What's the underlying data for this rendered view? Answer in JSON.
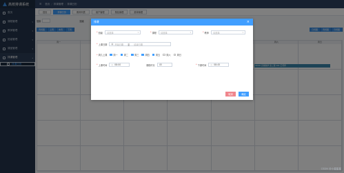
{
  "app": {
    "title": "高校排课系统"
  },
  "sidebar": {
    "items": [
      {
        "label": "首页"
      },
      {
        "label": "课程管理"
      },
      {
        "label": "教师管理"
      },
      {
        "label": "班级管理"
      },
      {
        "label": "课室管理"
      },
      {
        "label": "排课管理"
      },
      {
        "label": "排课日历"
      }
    ]
  },
  "header": {
    "crumbs": [
      "首页",
      "排课管理",
      "排课日历"
    ]
  },
  "tabs": [
    "首页",
    "排课日历",
    "教师列表",
    "用户管理",
    "角色管理",
    "菜单管理"
  ],
  "toolbar": {
    "search_label": "搜索",
    "class_label": "班级"
  },
  "calendar": {
    "view_buttons": [
      "周视图",
      "上周",
      "本周",
      "下周"
    ],
    "view_buttons_right": [
      "日视图",
      "周视图",
      "月视图"
    ],
    "week_days": [
      "周一",
      "周二",
      "周三",
      "周四",
      "周五",
      "周六",
      "周日"
    ],
    "event": "09:00 高等数学 第二课 101 王老师"
  },
  "modal": {
    "title": "排课",
    "close": "×",
    "fields": {
      "class_label": "班级",
      "course_label": "课程",
      "teacher_label": "教师",
      "placeholder": "请选择",
      "date_label": "上课日期",
      "date_start_placeholder": "开始日期",
      "date_sep": "至",
      "date_end_placeholder": "结束日期",
      "weekday_label": "周几上课",
      "weekdays": [
        "周一",
        "周二",
        "周三",
        "周四",
        "周五",
        "周六",
        "周日"
      ],
      "start_time_label": "上课时间",
      "start_time": "08:00",
      "duration_label": "课程时长",
      "duration": "45",
      "end_time_label": "下课时间",
      "end_time": "08:45"
    },
    "cancel": "取消",
    "confirm": "确定"
  },
  "watermark": "CSDN @小星星星"
}
